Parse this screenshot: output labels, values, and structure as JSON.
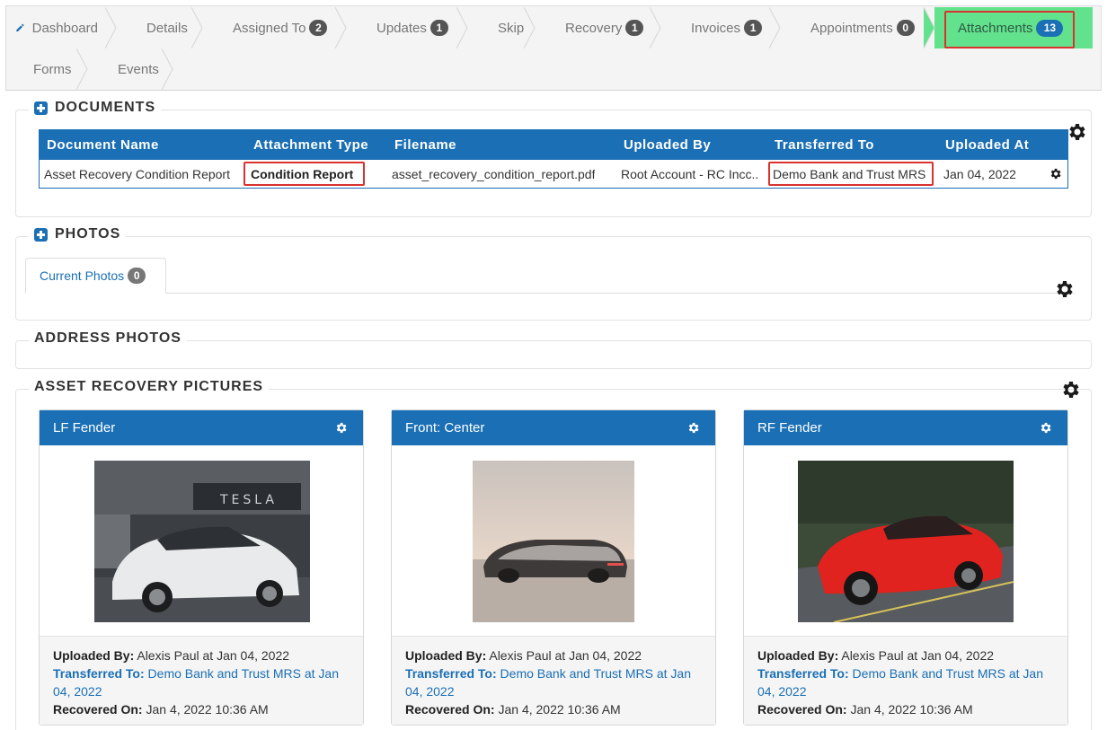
{
  "nav": {
    "row1": [
      {
        "label": "Dashboard",
        "badge": null
      },
      {
        "label": "Details",
        "badge": null
      },
      {
        "label": "Assigned To",
        "badge": "2"
      },
      {
        "label": "Updates",
        "badge": "1"
      },
      {
        "label": "Skip",
        "badge": null
      },
      {
        "label": "Recovery",
        "badge": "1"
      },
      {
        "label": "Invoices",
        "badge": "1"
      },
      {
        "label": "Appointments",
        "badge": "0"
      },
      {
        "label": "Attachments",
        "badge": "13"
      }
    ],
    "row2": [
      {
        "label": "Forms"
      },
      {
        "label": "Events"
      }
    ],
    "active_color": "#62e28d"
  },
  "documents": {
    "title": "DOCUMENTS",
    "columns": [
      "Document Name",
      "Attachment Type",
      "Filename",
      "Uploaded By",
      "Transferred To",
      "Uploaded At"
    ],
    "rows": [
      {
        "name": "Asset Recovery Condition Report",
        "type": "Condition Report",
        "filename": "asset_recovery_condition_report.pdf",
        "uploaded_by": "Root Account - RC Incc..",
        "transferred_to": "Demo Bank and Trust MRS",
        "uploaded_at": "Jan 04, 2022"
      }
    ]
  },
  "photos": {
    "title": "PHOTOS",
    "tab_label": "Current Photos",
    "tab_badge": "0"
  },
  "address_photos": {
    "title": "ADDRESS PHOTOS"
  },
  "asset_pictures": {
    "title": "ASSET RECOVERY PICTURES",
    "cards": [
      {
        "title": "LF Fender",
        "uploaded_label": "Uploaded By:",
        "uploaded_value": "Alexis Paul at Jan 04, 2022",
        "transferred_label": "Transferred To:",
        "transferred_value": "Demo Bank and Trust MRS at Jan 04, 2022",
        "recovered_label": "Recovered On:",
        "recovered_value": "Jan 4, 2022 10:36 AM"
      },
      {
        "title": "Front: Center",
        "uploaded_label": "Uploaded By:",
        "uploaded_value": "Alexis Paul at Jan 04, 2022",
        "transferred_label": "Transferred To:",
        "transferred_value": "Demo Bank and Trust MRS at Jan 04, 2022",
        "recovered_label": "Recovered On:",
        "recovered_value": "Jan 4, 2022 10:36 AM"
      },
      {
        "title": "RF Fender",
        "uploaded_label": "Uploaded By:",
        "uploaded_value": "Alexis Paul at Jan 04, 2022",
        "transferred_label": "Transferred To:",
        "transferred_value": "Demo Bank and Trust MRS at Jan 04, 2022",
        "recovered_label": "Recovered On:",
        "recovered_value": "Jan 4, 2022 10:36 AM"
      }
    ]
  },
  "colors": {
    "primary": "#1a6fb5",
    "highlight": "#d9322f",
    "badge": "#555555"
  }
}
